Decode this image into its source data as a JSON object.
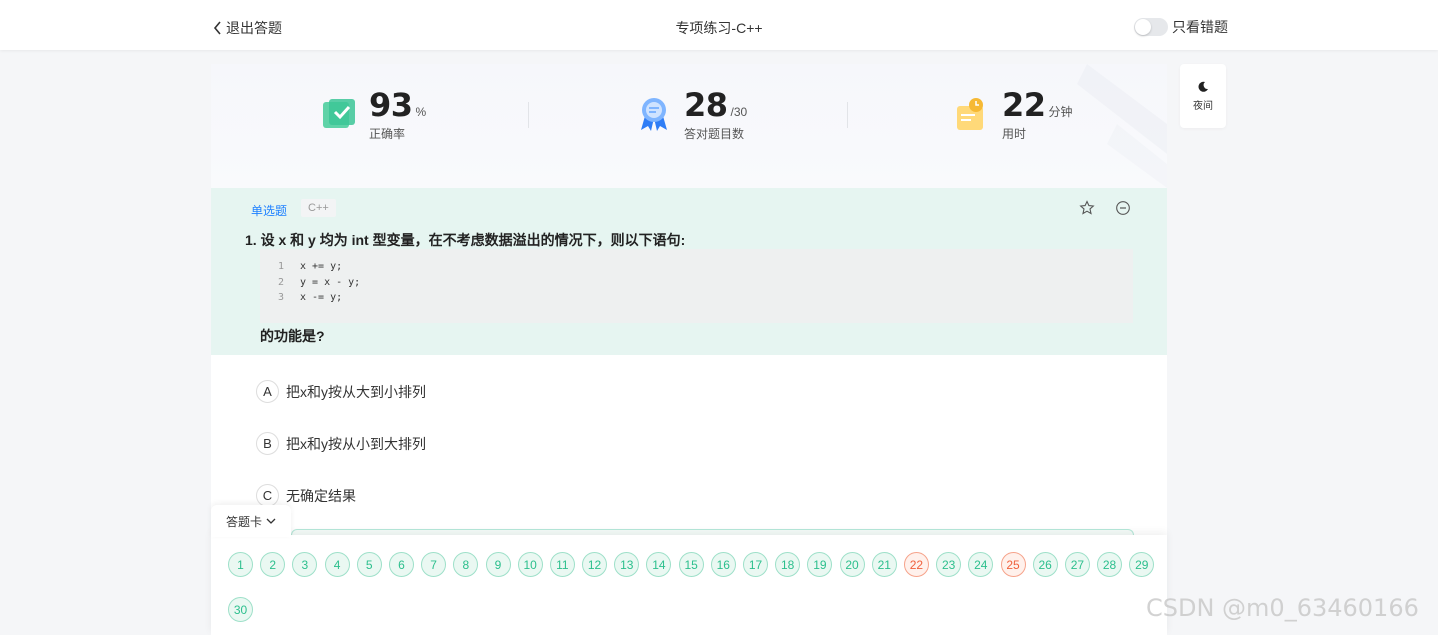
{
  "header": {
    "exit_label": "退出答题",
    "title": "专项练习-C++",
    "wrong_only_label": "只看错题"
  },
  "stats": {
    "accuracy": {
      "value": "93",
      "unit": "%",
      "label": "正确率"
    },
    "correct": {
      "value": "28",
      "unit": "/30",
      "label": "答对题目数"
    },
    "time": {
      "value": "22",
      "unit": "分钟",
      "label": "用时"
    }
  },
  "question": {
    "type": "单选题",
    "lang": "C++",
    "text": "1. 设 x 和 y 均为 int 型变量，在不考虑数据溢出的情况下，则以下语句:",
    "code": [
      {
        "ln": "1",
        "text": "x += y;"
      },
      {
        "ln": "2",
        "text": "y = x - y;"
      },
      {
        "ln": "3",
        "text": "x -= y;"
      }
    ],
    "tail": "的功能是?"
  },
  "options": [
    {
      "letter": "A",
      "text": "把x和y按从大到小排列"
    },
    {
      "letter": "B",
      "text": "把x和y按从小到大排列"
    },
    {
      "letter": "C",
      "text": "无确定结果"
    }
  ],
  "answer_card": {
    "tab_label": "答题卡",
    "numbers": [
      "1",
      "2",
      "3",
      "4",
      "5",
      "6",
      "7",
      "8",
      "9",
      "10",
      "11",
      "12",
      "13",
      "14",
      "15",
      "16",
      "17",
      "18",
      "19",
      "20",
      "21",
      "22",
      "23",
      "24",
      "25",
      "26",
      "27",
      "28",
      "29",
      "30"
    ],
    "wrong": [
      "22",
      "25"
    ]
  },
  "side": {
    "night_label": "夜间"
  },
  "watermark": "CSDN @m0_63460166",
  "colors": {
    "correct": "#2cbf8d",
    "wrong": "#f0603c",
    "accent": "#1e80ff"
  }
}
